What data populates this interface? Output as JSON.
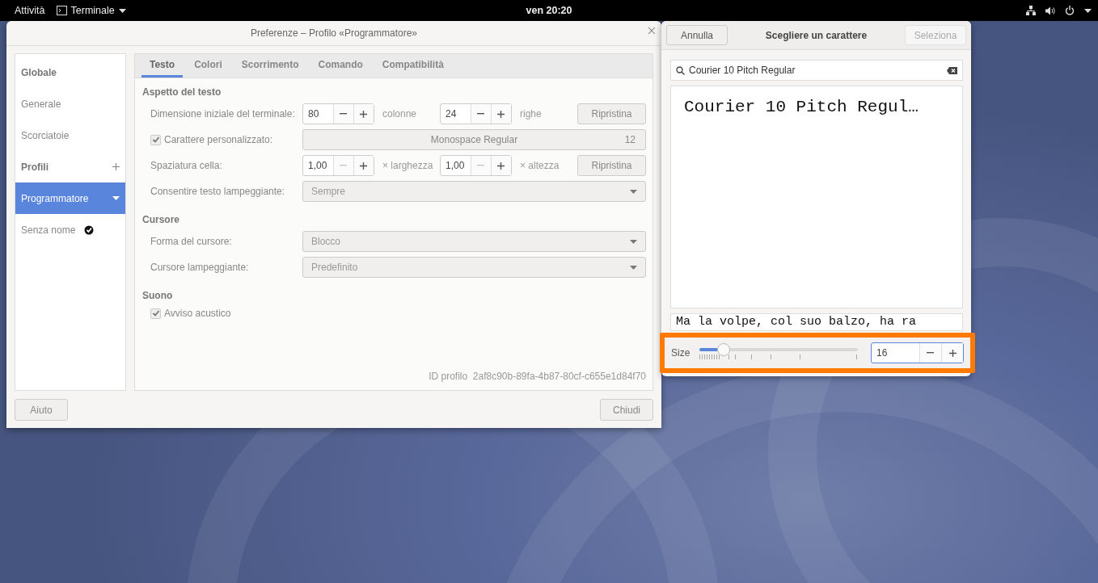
{
  "top_bar": {
    "activities": "Attività",
    "app_menu": "Terminale",
    "clock": "ven 20:20"
  },
  "preferences": {
    "title": "Preferenze – Profilo «Programmatore»",
    "sidebar": [
      {
        "label": "Globale",
        "kind": "header"
      },
      {
        "label": "Generale",
        "kind": "page",
        "selected": false
      },
      {
        "label": "Scorciatoie",
        "kind": "page",
        "selected": false
      },
      {
        "label": "Profili",
        "kind": "header_add"
      },
      {
        "label": "Programmatore",
        "kind": "profile",
        "selected": true,
        "default": false
      },
      {
        "label": "Senza nome",
        "kind": "profile",
        "selected": false,
        "default": true
      }
    ],
    "tabs": [
      {
        "label": "Testo",
        "selected": true
      },
      {
        "label": "Colori",
        "selected": false
      },
      {
        "label": "Scorrimento",
        "selected": false
      },
      {
        "label": "Comando",
        "selected": false
      },
      {
        "label": "Compatibilità",
        "selected": false
      }
    ],
    "sections": [
      {
        "title": "Aspetto del testo",
        "rows": [
          {
            "kind": "spin_pair",
            "label": "Dimensione iniziale del terminale:",
            "spins": [
              {
                "value": "80",
                "minus_disabled": false,
                "unit": "colonne"
              },
              {
                "value": "24",
                "minus_disabled": false,
                "unit": "righe"
              }
            ],
            "button": "Ripristina"
          },
          {
            "kind": "font",
            "label": "Carattere personalizzato:",
            "checked": true,
            "font": "Monospace Regular",
            "size": "12"
          },
          {
            "kind": "spin_pair",
            "label": "Spaziatura cella:",
            "spins": [
              {
                "value": "1,00",
                "minus_disabled": true,
                "unit": "× larghezza"
              },
              {
                "value": "1,00",
                "minus_disabled": true,
                "unit": "× altezza"
              }
            ],
            "button": "Ripristina"
          },
          {
            "kind": "combo",
            "label": "Consentire testo lampeggiante:",
            "value": "Sempre"
          }
        ]
      },
      {
        "title": "Cursore",
        "rows": [
          {
            "kind": "combo",
            "label": "Forma del cursore:",
            "value": "Blocco"
          },
          {
            "kind": "combo",
            "label": "Cursore lampeggiante:",
            "value": "Predefinito"
          }
        ]
      },
      {
        "title": "Suono",
        "rows": [
          {
            "kind": "checkbox",
            "label": "Avviso acustico",
            "checked": true
          }
        ]
      }
    ],
    "profile_id": "ID profilo  2af8c90b-89fa-4b87-80cf-c655e1d84f70",
    "help_button": "Aiuto",
    "close_button": "Chiudi"
  },
  "font_chooser": {
    "cancel_button": "Annulla",
    "title": "Scegliere un carattere",
    "select_button": {
      "label": "Seleziona",
      "disabled": true
    },
    "search": {
      "value": "Courier 10 Pitch Regular"
    },
    "preview_name": "Courier 10 Pitch Regul…",
    "sample_text": "Ma la volpe, col suo balzo, ha ra",
    "size": {
      "label": "Size",
      "level": 0.15,
      "value": "16"
    }
  }
}
